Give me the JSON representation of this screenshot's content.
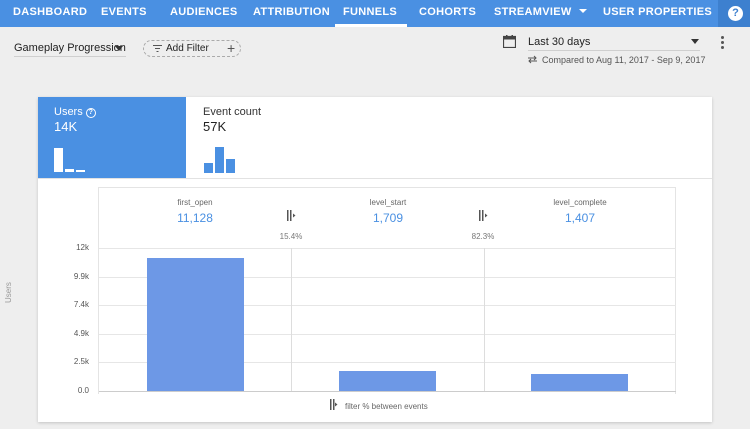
{
  "nav": {
    "tabs": [
      {
        "label": "DASHBOARD"
      },
      {
        "label": "EVENTS"
      },
      {
        "label": "AUDIENCES"
      },
      {
        "label": "ATTRIBUTION"
      },
      {
        "label": "FUNNELS",
        "active": true
      },
      {
        "label": "COHORTS"
      },
      {
        "label": "STREAMVIEW",
        "has_dropdown": true
      },
      {
        "label": "USER PROPERTIES"
      }
    ],
    "help_icon": "?"
  },
  "toolbar": {
    "funnel_name": "Gameplay Progression",
    "add_filter_label": "Add Filter",
    "date_range": "Last 30 days",
    "compare_text": "Compared to Aug 11, 2017 - Sep 9, 2017"
  },
  "metrics": {
    "users": {
      "label": "Users",
      "value": "14K",
      "selected": true
    },
    "event_count": {
      "label": "Event count",
      "value": "57K"
    }
  },
  "steps": [
    {
      "name": "first_open",
      "value": "11,128"
    },
    {
      "name": "level_start",
      "value": "1,709"
    },
    {
      "name": "level_complete",
      "value": "1,407"
    }
  ],
  "conversions": [
    "15.4%",
    "82.3%"
  ],
  "legend": {
    "text": "filter % between events"
  },
  "colors": {
    "nav": "#4a90e2",
    "bar": "#6d98e6",
    "value_text": "#4a90e2"
  },
  "chart_data": {
    "type": "bar",
    "categories": [
      "first_open",
      "level_start",
      "level_complete"
    ],
    "values": [
      11128,
      1709,
      1407
    ],
    "title": "",
    "xlabel": "",
    "ylabel": "Users",
    "ylim": [
      0,
      12000
    ],
    "y_ticks": [
      "12k",
      "9.9k",
      "7.4k",
      "4.9k",
      "2.5k",
      "0.0"
    ],
    "grid": true
  }
}
